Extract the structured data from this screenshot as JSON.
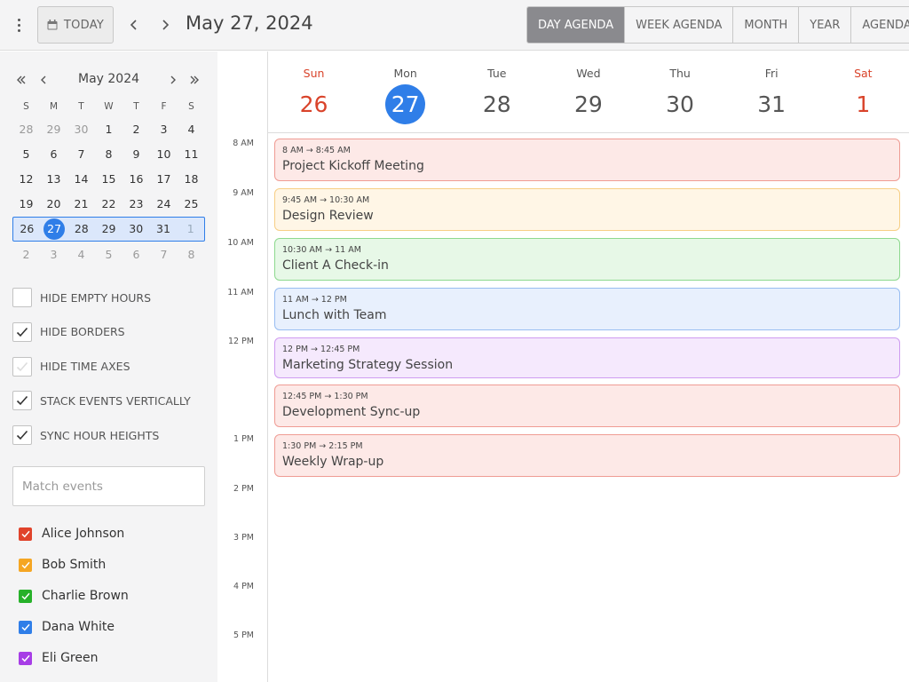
{
  "toolbar": {
    "today_label": "TODAY",
    "current_date": "May 27, 2024",
    "views": [
      {
        "label": "DAY AGENDA",
        "active": true
      },
      {
        "label": "WEEK AGENDA",
        "active": false
      },
      {
        "label": "MONTH",
        "active": false
      },
      {
        "label": "YEAR",
        "active": false
      },
      {
        "label": "AGENDA",
        "active": false
      }
    ]
  },
  "mini_calendar": {
    "title": "May 2024",
    "weekdays": [
      "S",
      "M",
      "T",
      "W",
      "T",
      "F",
      "S"
    ],
    "weeks": [
      [
        "28",
        "29",
        "30",
        "1",
        "2",
        "3",
        "4"
      ],
      [
        "5",
        "6",
        "7",
        "8",
        "9",
        "10",
        "11"
      ],
      [
        "12",
        "13",
        "14",
        "15",
        "16",
        "17",
        "18"
      ],
      [
        "19",
        "20",
        "21",
        "22",
        "23",
        "24",
        "25"
      ],
      [
        "26",
        "27",
        "28",
        "29",
        "30",
        "31",
        "1"
      ],
      [
        "2",
        "3",
        "4",
        "5",
        "6",
        "7",
        "8"
      ]
    ],
    "today": "27",
    "selected_week_index": 4
  },
  "options": [
    {
      "label": "HIDE EMPTY HOURS",
      "checked": false
    },
    {
      "label": "HIDE BORDERS",
      "checked": true
    },
    {
      "label": "HIDE TIME AXES",
      "checked": false
    },
    {
      "label": "STACK EVENTS VERTICALLY",
      "checked": true
    },
    {
      "label": "SYNC HOUR HEIGHTS",
      "checked": true
    }
  ],
  "search": {
    "placeholder": "Match events",
    "value": ""
  },
  "people": [
    {
      "name": "Alice Johnson",
      "color": "#e0432b",
      "checked": true
    },
    {
      "name": "Bob Smith",
      "color": "#f5a623",
      "checked": true
    },
    {
      "name": "Charlie Brown",
      "color": "#27b12a",
      "checked": true
    },
    {
      "name": "Dana White",
      "color": "#2f7ee8",
      "checked": true
    },
    {
      "name": "Eli Green",
      "color": "#a73de6",
      "checked": true
    }
  ],
  "days": [
    {
      "name": "Sun",
      "num": "26",
      "weekend": true,
      "today": false
    },
    {
      "name": "Mon",
      "num": "27",
      "weekend": false,
      "today": true
    },
    {
      "name": "Tue",
      "num": "28",
      "weekend": false,
      "today": false
    },
    {
      "name": "Wed",
      "num": "29",
      "weekend": false,
      "today": false
    },
    {
      "name": "Thu",
      "num": "30",
      "weekend": false,
      "today": false
    },
    {
      "name": "Fri",
      "num": "31",
      "weekend": false,
      "today": false
    },
    {
      "name": "Sat",
      "num": "1",
      "weekend": true,
      "today": false
    }
  ],
  "time_axis": [
    "8 AM",
    "9 AM",
    "10 AM",
    "11 AM",
    "12 PM",
    "1 PM",
    "2 PM",
    "3 PM",
    "4 PM",
    "5 PM"
  ],
  "events": [
    {
      "time": "8 AM → 8:45 AM",
      "title": "Project Kickoff Meeting",
      "bg": "#fde9e7",
      "border": "#ef9c94"
    },
    {
      "time": "9:45 AM → 10:30 AM",
      "title": "Design Review",
      "bg": "#fff6e6",
      "border": "#f7cf86"
    },
    {
      "time": "10:30 AM → 11 AM",
      "title": "Client A Check-in",
      "bg": "#e7f8e7",
      "border": "#8ed98f"
    },
    {
      "time": "11 AM → 12 PM",
      "title": "Lunch with Team",
      "bg": "#e8f0fd",
      "border": "#98bdf2"
    },
    {
      "time": "12 PM → 12:45 PM",
      "title": "Marketing Strategy Session",
      "bg": "#f5e9fd",
      "border": "#cf9cf1"
    },
    {
      "time": "12:45 PM → 1:30 PM",
      "title": "Development Sync-up",
      "bg": "#fde9e7",
      "border": "#ef9c94"
    },
    {
      "time": "1:30 PM → 2:15 PM",
      "title": "Weekly Wrap-up",
      "bg": "#fde9e7",
      "border": "#ef9c94"
    }
  ]
}
